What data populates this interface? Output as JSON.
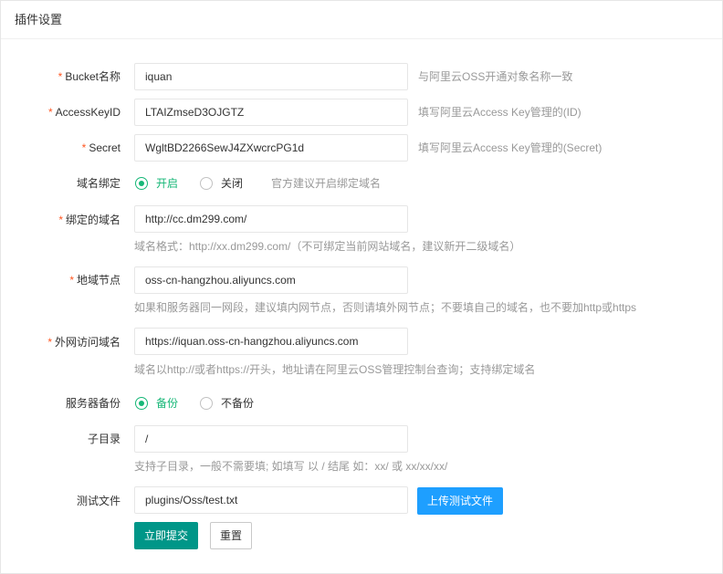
{
  "panel": {
    "title": "插件设置"
  },
  "required_mark": "*",
  "fields": {
    "bucket": {
      "label": "Bucket名称",
      "value": "iquan",
      "aux": "与阿里云OSS开通对象名称一致"
    },
    "accesskey": {
      "label": "AccessKeyID",
      "value": "LTAIZmseD3OJGTZ",
      "aux": "填写阿里云Access Key管理的(ID)"
    },
    "secret": {
      "label": "Secret",
      "value": "WgltBD2266SewJ4ZXwcrcPG1d",
      "aux": "填写阿里云Access Key管理的(Secret)"
    },
    "domain_bind": {
      "label": "域名绑定",
      "options": [
        "开启",
        "关闭"
      ],
      "selected": "开启",
      "aux": "官方建议开启绑定域名"
    },
    "bound_domain": {
      "label": "绑定的域名",
      "value": "http://cc.dm299.com/",
      "help": "域名格式：http://xx.dm299.com/（不可绑定当前网站域名，建议新开二级域名）"
    },
    "region_node": {
      "label": "地域节点",
      "value": "oss-cn-hangzhou.aliyuncs.com",
      "help": "如果和服务器同一网段，建议填内网节点，否则请填外网节点；不要填自己的域名，也不要加http或https"
    },
    "external_domain": {
      "label": "外网访问域名",
      "value": "https://iquan.oss-cn-hangzhou.aliyuncs.com",
      "help": "域名以http://或者https://开头，地址请在阿里云OSS管理控制台查询；支持绑定域名"
    },
    "server_backup": {
      "label": "服务器备份",
      "options": [
        "备份",
        "不备份"
      ],
      "selected": "备份"
    },
    "subdir": {
      "label": "子目录",
      "value": "/",
      "help": "支持子目录，一般不需要填; 如填写 以 / 结尾 如：xx/ 或 xx/xx/xx/"
    },
    "test_file": {
      "label": "测试文件",
      "value": "plugins/Oss/test.txt",
      "upload_label": "上传测试文件"
    }
  },
  "actions": {
    "submit_label": "立即提交",
    "reset_label": "重置"
  },
  "colors": {
    "accent_green": "#16b777",
    "primary": "#009688",
    "upload_blue": "#1e9fff",
    "required": "#ff5722"
  }
}
